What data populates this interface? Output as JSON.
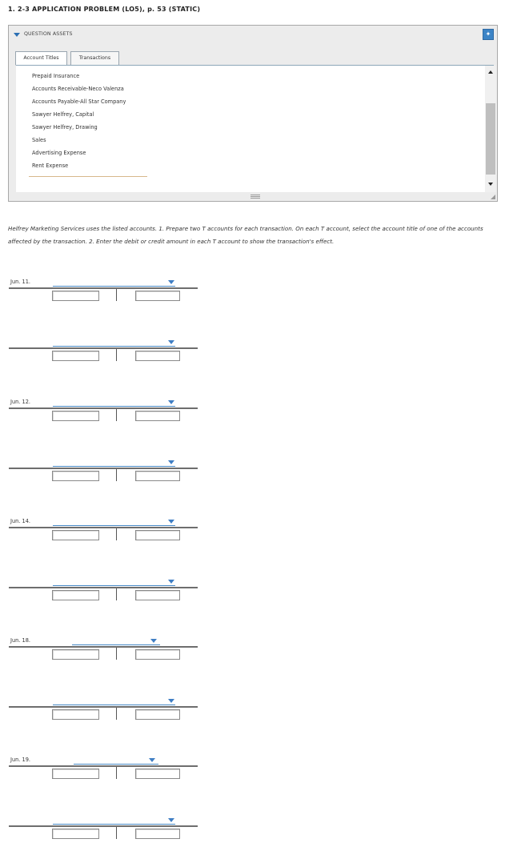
{
  "problem": {
    "title": "1. 2-3 APPLICATION PROBLEM (LO5), p. 53 (STATIC)"
  },
  "question_assets": {
    "label": "QUESTION ASSETS",
    "tabs": [
      {
        "label": "Account Titles",
        "active": true
      },
      {
        "label": "Transactions",
        "active": false
      }
    ],
    "accounts": [
      "Prepaid Insurance",
      "Accounts Receivable-Neco Valenza",
      "Accounts Payable-All Star Company",
      "Sawyer Helfrey, Capital",
      "Sawyer Helfrey, Drawing",
      "Sales",
      "Advertising Expense",
      "Rent Expense"
    ]
  },
  "instructions": "Helfrey Marketing Services uses the listed accounts. 1. Prepare two T accounts for each transaction. On each T account, select the account title of one of the accounts affected by the transaction. 2. Enter the debit or credit amount in each T account to show the transaction's effect.",
  "transactions": [
    {
      "date": "Jun. 11."
    },
    {
      "date": "Jun. 12."
    },
    {
      "date": "Jun. 14."
    },
    {
      "date": "Jun. 18."
    },
    {
      "date": "Jun. 19."
    }
  ],
  "colors": {
    "accent": "#3f7ec4",
    "panel_bg": "#ececec",
    "pin_button": "#3c84c6"
  },
  "icons": {
    "collapse": "caret-down-icon",
    "pin": "pin-icon",
    "scroll_up": "arrow-up-icon",
    "scroll_down": "arrow-down-icon",
    "dropdown": "chevron-down-icon",
    "resize": "resize-handle-icon"
  }
}
